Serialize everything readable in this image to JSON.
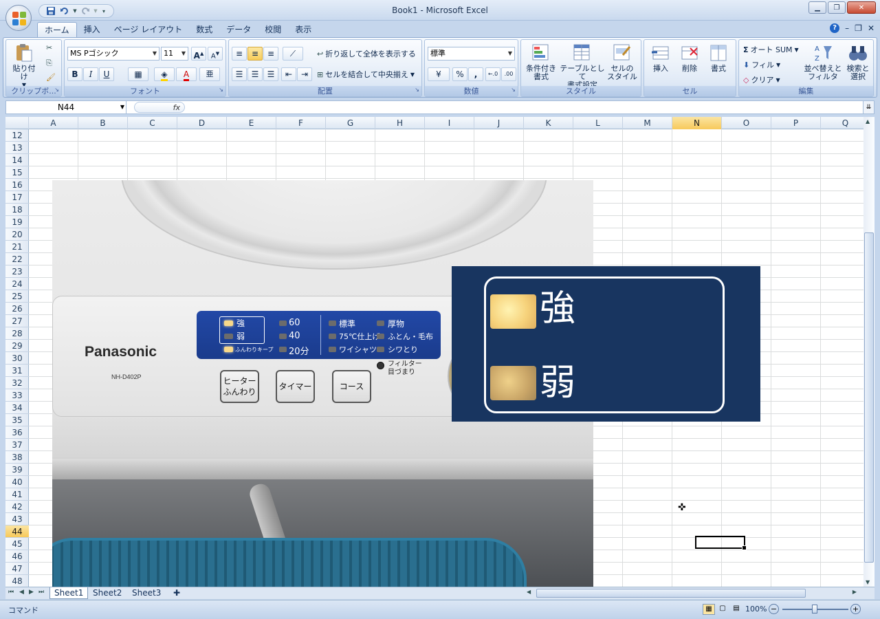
{
  "window": {
    "title": "Book1 - Microsoft Excel"
  },
  "tabs": [
    {
      "label": "ホーム",
      "active": true
    },
    {
      "label": "挿入"
    },
    {
      "label": "ページ レイアウト"
    },
    {
      "label": "数式"
    },
    {
      "label": "データ"
    },
    {
      "label": "校閲"
    },
    {
      "label": "表示"
    }
  ],
  "ribbon": {
    "clipboard": {
      "caption": "クリップボ...",
      "paste_label": "貼り付け"
    },
    "font": {
      "caption": "フォント",
      "name": "MS Pゴシック",
      "size": "11",
      "bold": "B",
      "italic": "I",
      "underline": "U",
      "grow": "A",
      "shrink": "A",
      "font_color_letter": "A",
      "phonetic": "亜"
    },
    "alignment": {
      "caption": "配置",
      "wrap_label": "折り返して全体を表示する",
      "merge_label": "セルを結合して中央揃え"
    },
    "number": {
      "caption": "数値",
      "format": "標準",
      "percent": "%",
      "comma": ","
    },
    "styles": {
      "caption": "スタイル",
      "cond_label": "条件付き\n書式",
      "table_label": "テーブルとして\n書式設定",
      "cellstyle_label": "セルの\nスタイル"
    },
    "cells": {
      "caption": "セル",
      "insert_label": "挿入",
      "delete_label": "削除",
      "format_label": "書式"
    },
    "editing": {
      "caption": "編集",
      "autosum_label": "オート SUM",
      "fill_label": "フィル",
      "clear_label": "クリア",
      "sort_label": "並べ替えと\nフィルタ",
      "find_label": "検索と\n選択"
    }
  },
  "formula_bar": {
    "name_box": "N44",
    "fx": "fx",
    "value": ""
  },
  "grid": {
    "columns": [
      "A",
      "B",
      "C",
      "D",
      "E",
      "F",
      "G",
      "H",
      "I",
      "J",
      "K",
      "L",
      "M",
      "N",
      "O",
      "P",
      "Q"
    ],
    "rows": [
      "12",
      "13",
      "14",
      "15",
      "16",
      "17",
      "18",
      "19",
      "20",
      "21",
      "22",
      "23",
      "24",
      "25",
      "26",
      "27",
      "28",
      "29",
      "30",
      "31",
      "32",
      "33",
      "34",
      "35",
      "36",
      "37",
      "38",
      "39",
      "40",
      "41",
      "42",
      "43",
      "44",
      "45",
      "46",
      "47",
      "48"
    ],
    "selected_col": "N",
    "selected_row": "44"
  },
  "photo": {
    "brand": "Panasonic",
    "model": "NH-D402P",
    "heat_strong": "強",
    "heat_weak": "弱",
    "keep_label": "ふんわりキープ",
    "timer_60": "60",
    "timer_40": "40",
    "timer_20": "20分",
    "course_standard": "標準",
    "course_75": "75℃仕上げ",
    "course_shirt": "ワイシャツ",
    "course_thick": "厚物",
    "course_futon": "ふとん・毛布",
    "course_wrinkle": "シワとり",
    "filter_label": "フィルター\n目づまり",
    "btn_heater": "ヒーター\nふんわり",
    "btn_timer": "タイマー",
    "btn_course": "コース"
  },
  "zoom_panel": {
    "strong_label": "強",
    "weak_label": "弱"
  },
  "sheets": [
    {
      "label": "Sheet1",
      "active": true
    },
    {
      "label": "Sheet2"
    },
    {
      "label": "Sheet3"
    }
  ],
  "status": {
    "mode": "コマンド",
    "zoom": "100%"
  },
  "colors": {
    "ribbon_bg": "#dbe6f4",
    "selection": "#f7c95b",
    "panel": "#183560",
    "lamp": "#f5d27a"
  }
}
